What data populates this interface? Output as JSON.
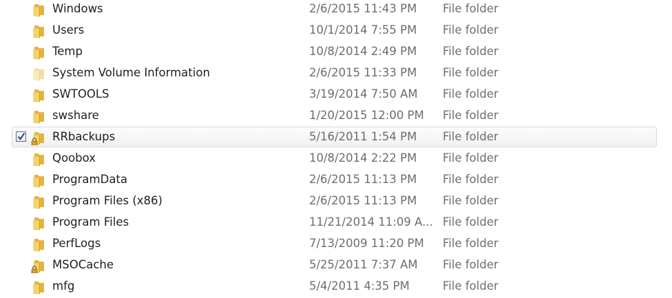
{
  "rows": [
    {
      "name": "Windows",
      "date": "2/6/2015 11:43 PM",
      "type": "File folder",
      "icon": "folder-icon",
      "locked": false,
      "faded": false,
      "selected": false
    },
    {
      "name": "Users",
      "date": "10/1/2014 7:55 PM",
      "type": "File folder",
      "icon": "folder-icon",
      "locked": false,
      "faded": false,
      "selected": false
    },
    {
      "name": "Temp",
      "date": "10/8/2014 2:49 PM",
      "type": "File folder",
      "icon": "folder-icon",
      "locked": false,
      "faded": false,
      "selected": false
    },
    {
      "name": "System Volume Information",
      "date": "2/6/2015 11:33 PM",
      "type": "File folder",
      "icon": "folder-icon",
      "locked": false,
      "faded": true,
      "selected": false
    },
    {
      "name": "SWTOOLS",
      "date": "3/19/2014 7:50 AM",
      "type": "File folder",
      "icon": "folder-icon",
      "locked": false,
      "faded": false,
      "selected": false
    },
    {
      "name": "swshare",
      "date": "1/20/2015 12:00 PM",
      "type": "File folder",
      "icon": "folder-icon",
      "locked": false,
      "faded": false,
      "selected": false
    },
    {
      "name": "RRbackups",
      "date": "5/16/2011 1:54 PM",
      "type": "File folder",
      "icon": "folder-icon",
      "locked": true,
      "faded": false,
      "selected": true
    },
    {
      "name": "Qoobox",
      "date": "10/8/2014 2:22 PM",
      "type": "File folder",
      "icon": "folder-icon",
      "locked": false,
      "faded": false,
      "selected": false
    },
    {
      "name": "ProgramData",
      "date": "2/6/2015 11:13 PM",
      "type": "File folder",
      "icon": "folder-icon",
      "locked": false,
      "faded": false,
      "selected": false
    },
    {
      "name": "Program Files (x86)",
      "date": "2/6/2015 11:13 PM",
      "type": "File folder",
      "icon": "folder-icon",
      "locked": false,
      "faded": false,
      "selected": false
    },
    {
      "name": "Program Files",
      "date": "11/21/2014 11:09 A...",
      "type": "File folder",
      "icon": "folder-icon",
      "locked": false,
      "faded": false,
      "selected": false
    },
    {
      "name": "PerfLogs",
      "date": "7/13/2009 11:20 PM",
      "type": "File folder",
      "icon": "folder-icon",
      "locked": false,
      "faded": false,
      "selected": false
    },
    {
      "name": "MSOCache",
      "date": "5/25/2011 7:37 AM",
      "type": "File folder",
      "icon": "folder-icon",
      "locked": true,
      "faded": false,
      "selected": false
    },
    {
      "name": "mfg",
      "date": "5/4/2011 4:35 PM",
      "type": "File folder",
      "icon": "folder-icon",
      "locked": false,
      "faded": false,
      "selected": false
    }
  ],
  "colors": {
    "folder_front": "#f6d46a",
    "folder_back": "#e3b440",
    "selection_border": "#d9d9d9",
    "secondary_text": "#6d6d6d",
    "checkmark": "#1f3f86"
  }
}
